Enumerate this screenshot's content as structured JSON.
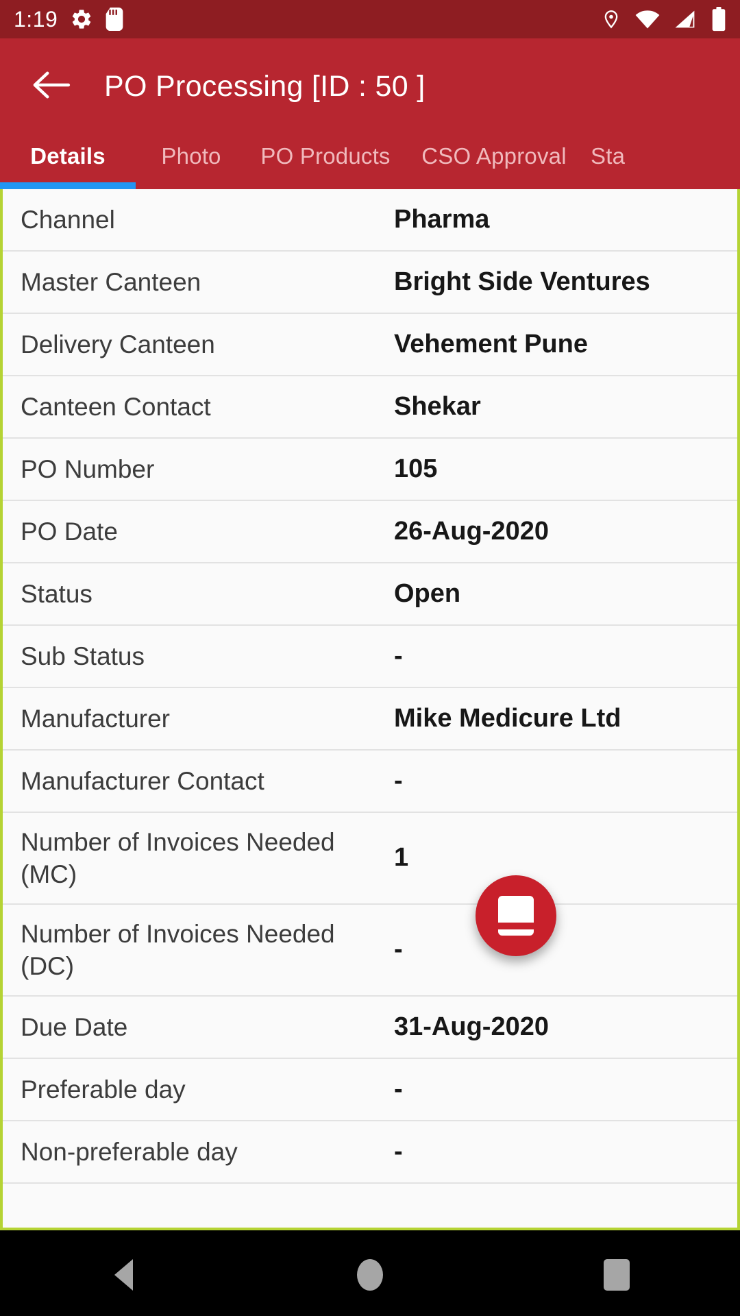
{
  "status_bar": {
    "time": "1:19",
    "left_icons": [
      "gear-icon",
      "sd-card-icon"
    ],
    "right_icons": [
      "location-pin-icon",
      "wifi-icon",
      "cellular-signal-icon",
      "battery-icon"
    ],
    "background_color": "#8e1d22"
  },
  "app_bar": {
    "back_icon": "back-arrow-icon",
    "title": "PO Processing  [ID : 50 ]",
    "background_color": "#b72630"
  },
  "tabs": {
    "active_index": 0,
    "indicator_color": "#2196f3",
    "items": [
      {
        "label": "Details"
      },
      {
        "label": "Photo"
      },
      {
        "label": "PO Products"
      },
      {
        "label": "CSO Approval"
      },
      {
        "label": "Sta"
      }
    ]
  },
  "details": {
    "rows": [
      {
        "label": "Channel",
        "value": "Pharma",
        "lines": 1
      },
      {
        "label": "Master Canteen",
        "value": "Bright Side Ventures",
        "lines": 1
      },
      {
        "label": "Delivery Canteen",
        "value": "Vehement Pune",
        "lines": 1
      },
      {
        "label": "Canteen Contact",
        "value": "Shekar",
        "lines": 1
      },
      {
        "label": "PO Number",
        "value": "105",
        "lines": 1
      },
      {
        "label": "PO Date",
        "value": "26-Aug-2020",
        "lines": 1
      },
      {
        "label": "Status",
        "value": "Open",
        "lines": 1
      },
      {
        "label": "Sub Status",
        "value": "-",
        "lines": 1
      },
      {
        "label": "Manufacturer",
        "value": "Mike Medicure Ltd",
        "lines": 1
      },
      {
        "label": "Manufacturer Contact",
        "value": "-",
        "lines": 1
      },
      {
        "label": "Number of Invoices Needed (MC)",
        "value": "1",
        "lines": 2
      },
      {
        "label": "Number of Invoices Needed (DC)",
        "value": "-",
        "lines": 2
      },
      {
        "label": "Due Date",
        "value": "31-Aug-2020",
        "lines": 1
      },
      {
        "label": "Preferable day",
        "value": "-",
        "lines": 1
      },
      {
        "label": "Non-preferable day",
        "value": "-",
        "lines": 1
      }
    ]
  },
  "fab": {
    "icon": "note-card-icon",
    "color": "#c8202b"
  },
  "nav_bar": {
    "back_icon": "triangle-back-icon",
    "home_icon": "circle-home-icon",
    "recents_icon": "square-recents-icon"
  }
}
